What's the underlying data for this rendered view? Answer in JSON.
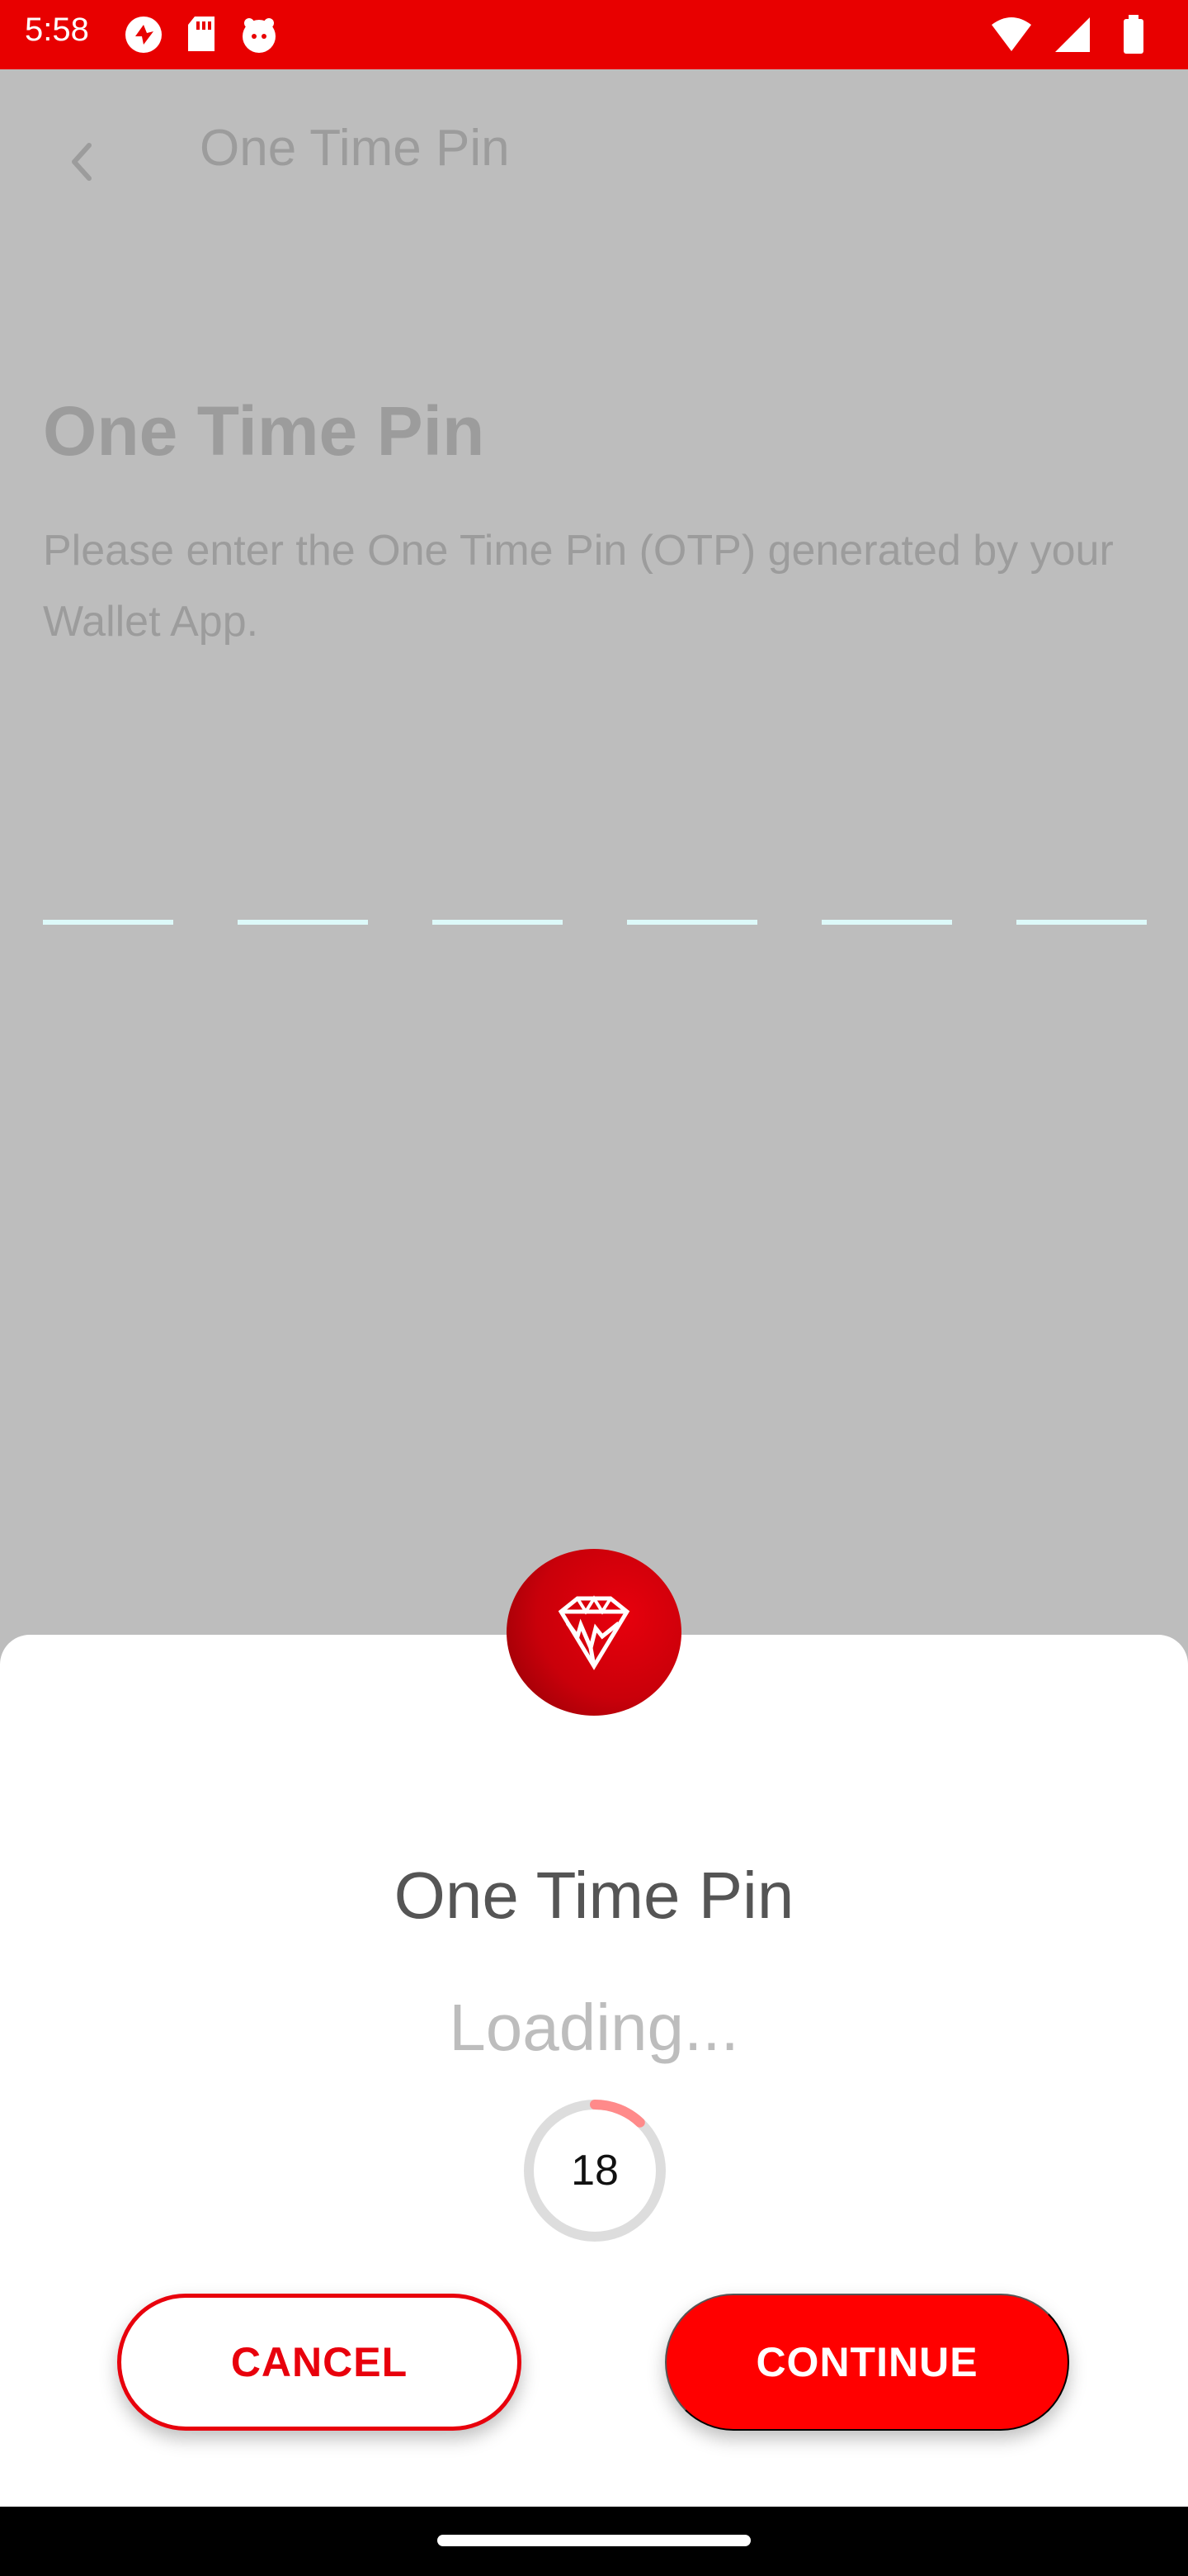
{
  "status_bar": {
    "time": "5:58",
    "color": "#e80000",
    "left_icons": [
      "sync-icon",
      "sd-card-icon",
      "app-face-icon"
    ],
    "right_icons": [
      "wifi-icon",
      "signal-icon",
      "battery-icon"
    ]
  },
  "background_screen": {
    "toolbar_title": "One Time Pin",
    "title": "One Time Pin",
    "description": "Please enter the One Time Pin (OTP) generated by your Wallet App.",
    "otp_slots": 6
  },
  "sheet": {
    "logo_icon": "diamond-logo-icon",
    "title": "One Time Pin",
    "loading_text": "Loading...",
    "countdown": "18",
    "countdown_progress": 0.12,
    "cancel_label": "CANCEL",
    "continue_label": "CONTINUE",
    "accent_color": "#e8000c"
  }
}
